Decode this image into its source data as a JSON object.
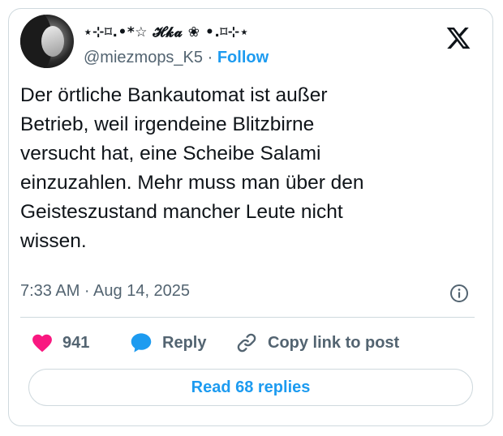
{
  "author": {
    "display_name": "⋆⊹⌑.•*☆ 𝓗𝓴𝓪 ❀ •.⌑⊹⋆",
    "handle": "@miezmops_K5",
    "separator": "·",
    "follow_label": "Follow"
  },
  "tweet": {
    "text": "Der örtliche Bankautomat ist außer\nBetrieb, weil irgendeine Blitzbirne\nversucht hat, eine Scheibe Salami\neinzuzahlen. Mehr muss man über den\nGeisteszustand mancher Leute nicht\nwissen.",
    "timestamp": "7:33 AM · Aug 14, 2025"
  },
  "actions": {
    "like_count": "941",
    "reply_label": "Reply",
    "copy_link_label": "Copy link to post"
  },
  "read_replies_label": "Read 68 replies",
  "icons": {
    "brand": "x-logo-icon",
    "info": "info-icon",
    "like": "heart-icon",
    "reply": "speech-bubble-icon",
    "copy": "link-icon"
  },
  "colors": {
    "accent": "#1d9bf0",
    "heart": "#f91880",
    "muted_text": "#536471",
    "border": "#cfd9de"
  }
}
